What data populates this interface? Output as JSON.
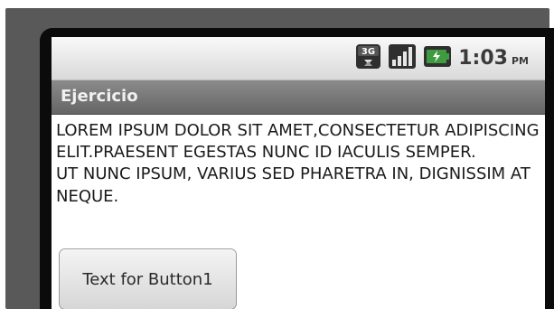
{
  "status_bar": {
    "time": "1:03",
    "ampm": "PM",
    "network_icon": "3g-data-icon",
    "signal_icon": "signal-bars-icon",
    "battery_icon": "battery-charging-icon",
    "network_label": "3G"
  },
  "app": {
    "title": "Ejercicio"
  },
  "content": {
    "paragraph1": "LOREM IPSUM DOLOR SIT AMET,CONSECTETUR ADIPISCING ELIT.PRAESENT EGESTAS NUNC ID IACULIS SEMPER.",
    "paragraph2": "UT NUNC IPSUM, VARIUS SED PHARETRA IN, DIGNISSIM AT NEQUE."
  },
  "button1": {
    "label": "Text for Button1"
  },
  "colors": {
    "titlebar": "#777777",
    "statusbar": "#e8e8e8",
    "battery_accent": "#3f9b3f"
  }
}
